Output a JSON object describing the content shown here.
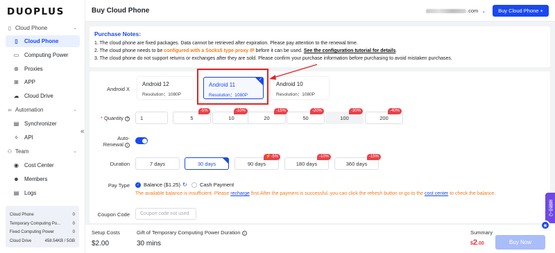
{
  "brand": "DUOPLUS",
  "header": {
    "title": "Buy Cloud Phone",
    "account_suffix": ".com",
    "buy_button": "Buy Cloud Phone +"
  },
  "sidebar": {
    "groups": [
      {
        "label": "Cloud Phone",
        "icon": "phone-icon"
      },
      {
        "label": "Automation",
        "icon": "automation-icon"
      },
      {
        "label": "Team",
        "icon": "team-icon"
      }
    ],
    "items": [
      {
        "label": "Cloud Phone",
        "icon": "phone-icon",
        "active": true
      },
      {
        "label": "Computing Power",
        "icon": "monitor-icon"
      },
      {
        "label": "Proxies",
        "icon": "proxy-icon"
      },
      {
        "label": "APP",
        "icon": "apps-grid-icon"
      },
      {
        "label": "Cloud Drive",
        "icon": "cloud-icon"
      },
      {
        "label": "Synchronizer",
        "icon": "sync-icon"
      },
      {
        "label": "API",
        "icon": "api-icon"
      },
      {
        "label": "Cost Center",
        "icon": "cost-icon"
      },
      {
        "label": "Members",
        "icon": "members-icon"
      },
      {
        "label": "Logs",
        "icon": "logs-icon"
      }
    ],
    "stats": [
      {
        "label": "Cloud Phone",
        "value": "0"
      },
      {
        "label": "Temporary Computing Po...",
        "value": "0"
      },
      {
        "label": "Fixed Computing Power",
        "value": "0"
      },
      {
        "label": "Cloud Drive",
        "value": "458.54KB / 5GB"
      }
    ]
  },
  "notes": {
    "title": "Purchase Notes:",
    "line1": "1. The cloud phone are fixed packages. Data cannot be retrieved after expiration. Please pay attention to the renewal time.",
    "line2_prefix": "2. The cloud phone needs to be ",
    "line2_highlight": "configured with a Socks5 type proxy IP",
    "line2_mid": " before it can be used. ",
    "line2_link": "See the configuration tutorial for details",
    "line2_end": ".",
    "line3": "3. The cloud phone do not support returns or exchanges after they are sold. Please confirm your purchase information before purchasing to avoid mistaken purchases."
  },
  "form": {
    "android_label": "Android X",
    "versions": [
      {
        "name": "Android 12",
        "resolution": "Resolution：1080P"
      },
      {
        "name": "Android 11",
        "resolution": "Resolution：1080P",
        "selected": true
      },
      {
        "name": "Android 10",
        "resolution": "Resolution：1080P"
      }
    ],
    "quantity_label": "Quantity",
    "quantity_required": "*",
    "quantity_value": "1",
    "quantity_options": [
      {
        "value": "5",
        "badge": "-5%"
      },
      {
        "value": "10",
        "badge": "-10%"
      },
      {
        "value": "20",
        "badge": "-15%"
      },
      {
        "value": "50",
        "badge": "-20%"
      },
      {
        "value": "100",
        "badge": "-30%"
      },
      {
        "value": "200",
        "badge": "-40%"
      }
    ],
    "auto_renewal_label_1": "Auto-",
    "auto_renewal_label_2": "Renewal",
    "auto_renewal_on": true,
    "duration_label": "Duration",
    "durations": [
      {
        "value": "7 days",
        "badge": ""
      },
      {
        "value": "30 days",
        "badge": "",
        "selected": true
      },
      {
        "value": "90 days",
        "badge": "⚡-5%"
      },
      {
        "value": "180 days",
        "badge": "-10%"
      },
      {
        "value": "360 days",
        "badge": "-15%"
      }
    ],
    "pay_type_label": "Pay Type",
    "pay_balance": "Balance ($1.25)",
    "pay_cash": "Cash Payment",
    "warn_prefix": "The available balance is insufficient. Please ",
    "warn_link1": "recharge",
    "warn_mid": " first.After the payment is successful, you can click the refresh button or go to the ",
    "warn_link2": "cost center",
    "warn_end": " to check the balance.",
    "coupon_label": "Coupon Code",
    "coupon_placeholder": "Coupon code not used"
  },
  "footer": {
    "setup_label": "Setup Costs",
    "setup_value": "$2.00",
    "gift_label": "Gift of Temporary Computing Power Duration",
    "gift_value": "30 mins",
    "summary_label": "Summary",
    "price_currency": "$",
    "price_int": "2",
    "price_dec": ".00",
    "buy_now": "Buy Now"
  },
  "float_tab": "客服中心",
  "colors": {
    "accent": "#1a49f0",
    "warning": "#f07c1a",
    "badge": "#e9424a",
    "annotation": "#e62020"
  }
}
